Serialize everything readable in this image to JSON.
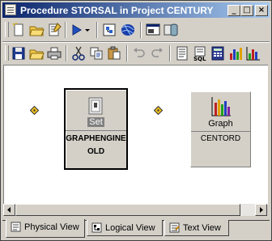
{
  "window": {
    "title": "Procedure STORSAL in Project CENTURY",
    "minimize": "_",
    "maximize": "□",
    "close": "×"
  },
  "toolbar1": [
    "new-icon",
    "open-folder-icon",
    "properties-icon",
    "run-icon",
    "run-dropdown-icon",
    "procedure-icon",
    "network-icon",
    "window-icon",
    "database-icon"
  ],
  "toolbar2": [
    "save-icon",
    "open-icon",
    "print-icon",
    "cut-icon",
    "copy-icon",
    "paste-icon",
    "undo-icon",
    "redo-icon",
    "report-icon",
    "sql-icon",
    "calculator-icon",
    "chart-icon",
    "bar-chart-icon"
  ],
  "diagram": {
    "nodes": [
      {
        "caption": "Set",
        "label": "GRAPHENGINE OLD",
        "icon": "set-file-icon",
        "selected": true
      },
      {
        "caption": "Graph",
        "label": "CENTORD",
        "icon": "graph-icon",
        "selected": false
      }
    ]
  },
  "tabs": [
    {
      "label": "Physical View",
      "icon": "physical-view-icon",
      "active": true
    },
    {
      "label": "Logical View",
      "icon": "logical-view-icon",
      "active": false
    },
    {
      "label": "Text View",
      "icon": "text-view-icon",
      "active": false
    }
  ]
}
